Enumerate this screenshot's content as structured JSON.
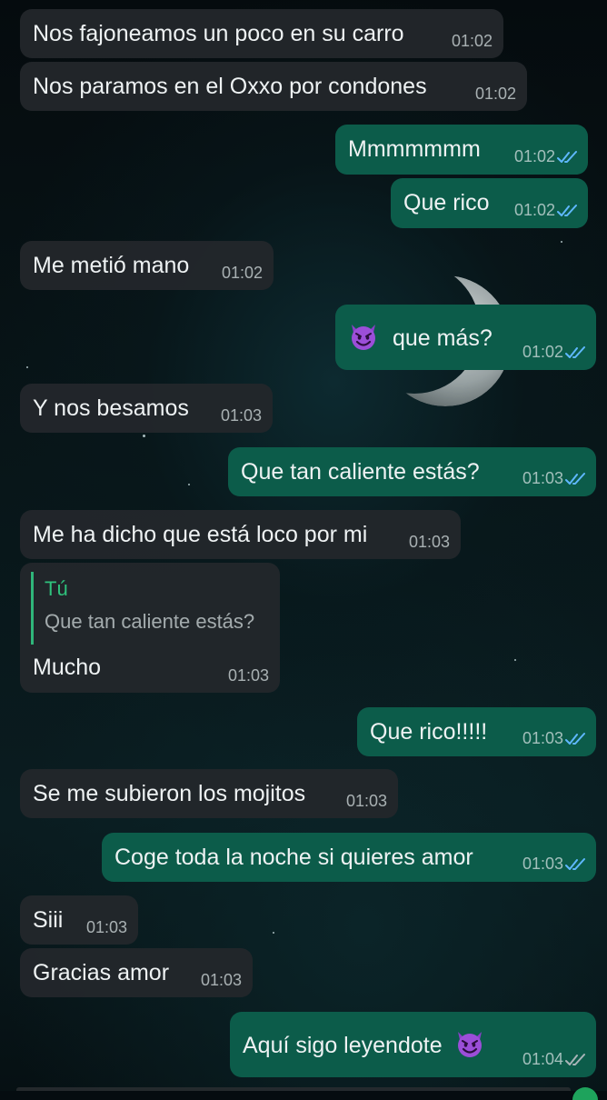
{
  "chat": {
    "reply_sender": "Tú",
    "messages": [
      {
        "text": "Nos fajoneamos un poco en su carro",
        "time": "01:02",
        "dir": "in"
      },
      {
        "text": "Nos paramos en el Oxxo por condones",
        "time": "01:02",
        "dir": "in"
      },
      {
        "text": "Mmmmmmm",
        "time": "01:02",
        "dir": "out",
        "status": "read"
      },
      {
        "text": "Que rico",
        "time": "01:02",
        "dir": "out",
        "status": "read"
      },
      {
        "text": "Me metió mano",
        "time": "01:02",
        "dir": "in"
      },
      {
        "text": "que más?",
        "time": "01:02",
        "dir": "out",
        "status": "read",
        "emoji": "smiling-imp"
      },
      {
        "text": "Y nos besamos",
        "time": "01:03",
        "dir": "in"
      },
      {
        "text": "Que tan caliente estás?",
        "time": "01:03",
        "dir": "out",
        "status": "read"
      },
      {
        "text": "Me ha dicho que está loco por mi",
        "time": "01:03",
        "dir": "in"
      },
      {
        "text": "Mucho",
        "time": "01:03",
        "dir": "in",
        "reply_to": "Que tan caliente estás?"
      },
      {
        "text": "Que rico!!!!!",
        "time": "01:03",
        "dir": "out",
        "status": "read"
      },
      {
        "text": "Se me subieron los mojitos",
        "time": "01:03",
        "dir": "in"
      },
      {
        "text": "Coge toda la noche si quieres amor",
        "time": "01:03",
        "dir": "out",
        "status": "read"
      },
      {
        "text": "Siii",
        "time": "01:03",
        "dir": "in"
      },
      {
        "text": "Gracias amor",
        "time": "01:03",
        "dir": "in"
      },
      {
        "text": "Aquí sigo leyendote",
        "time": "01:04",
        "dir": "out",
        "status": "delivered",
        "emoji": "smiling-imp"
      }
    ]
  },
  "colors": {
    "incoming_bubble": "#22262b",
    "outgoing_bubble": "#0c5c4a",
    "read_ticks": "#5fb8ff",
    "delivered_ticks": "#a9b4b8",
    "reply_accent": "#2fb67a"
  },
  "icons": {
    "read": "double-check-icon-blue",
    "delivered": "double-check-icon-gray",
    "emoji": "smiling-imp-emoji"
  }
}
